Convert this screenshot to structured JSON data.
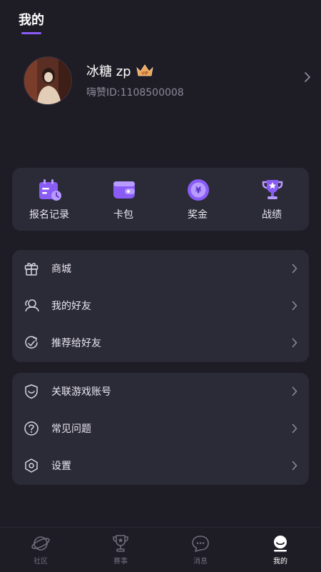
{
  "header": {
    "title": "我的"
  },
  "profile": {
    "name": "冰糖 zp",
    "vip_badge": "VIP",
    "user_id": "嗨赞ID:1108500008"
  },
  "quick_actions": [
    {
      "label": "报名记录",
      "icon": "calendar-clock-icon"
    },
    {
      "label": "卡包",
      "icon": "wallet-icon"
    },
    {
      "label": "奖金",
      "icon": "yuan-coin-icon"
    },
    {
      "label": "战绩",
      "icon": "trophy-icon"
    }
  ],
  "menu_group_1": [
    {
      "label": "商城",
      "icon": "gift-icon"
    },
    {
      "label": "我的好友",
      "icon": "friends-icon"
    },
    {
      "label": "推荐给好友",
      "icon": "share-icon"
    }
  ],
  "menu_group_2": [
    {
      "label": "关联游戏账号",
      "icon": "shield-link-icon"
    },
    {
      "label": "常见问题",
      "icon": "question-icon"
    },
    {
      "label": "设置",
      "icon": "settings-hex-icon"
    }
  ],
  "tabbar": [
    {
      "label": "社区",
      "icon": "planet-icon",
      "active": false
    },
    {
      "label": "赛事",
      "icon": "trophy-outline-icon",
      "active": false
    },
    {
      "label": "消息",
      "icon": "chat-bubble-icon",
      "active": false
    },
    {
      "label": "我的",
      "icon": "profile-icon",
      "active": true
    }
  ],
  "colors": {
    "background": "#1e1d26",
    "card": "#2b2a37",
    "accent": "#8a5cf6",
    "muted_text": "#8c8a98"
  }
}
